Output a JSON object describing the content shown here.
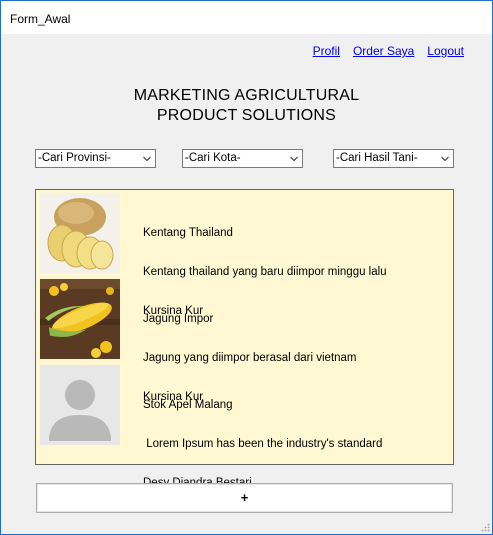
{
  "window": {
    "title": "Form_Awal"
  },
  "nav": {
    "profil": "Profil",
    "order": "Order Saya",
    "logout": "Logout",
    "link_color": "#0000ee"
  },
  "heading": {
    "line1": "MARKETING AGRICULTURAL",
    "line2": "PRODUCT SOLUTIONS"
  },
  "filters": {
    "provinsi": "-Cari Provinsi-",
    "kota": "-Cari Kota-",
    "hasil_tani": "-Cari Hasil Tani-"
  },
  "products": [
    {
      "title": "Kentang Thailand",
      "description": "Kentang thailand yang baru diimpor minggu lalu",
      "seller": "Kursina Kur",
      "image_icon": "potato-image"
    },
    {
      "title": "Jagung Impor",
      "description": "Jagung yang diimpor berasal dari vietnam",
      "seller": "Kursina Kur",
      "image_icon": "corn-image"
    },
    {
      "title": "Stok Apel Malang",
      "description": " Lorem Ipsum has been the industry's standard",
      "seller": "Desy Diandra Bestari",
      "image_icon": "default-avatar-icon"
    }
  ],
  "add_button": {
    "label": "+"
  },
  "colors": {
    "list_background": "#fff8d2",
    "window_background": "#f0f0f0",
    "window_border": "#1f6fc7"
  }
}
